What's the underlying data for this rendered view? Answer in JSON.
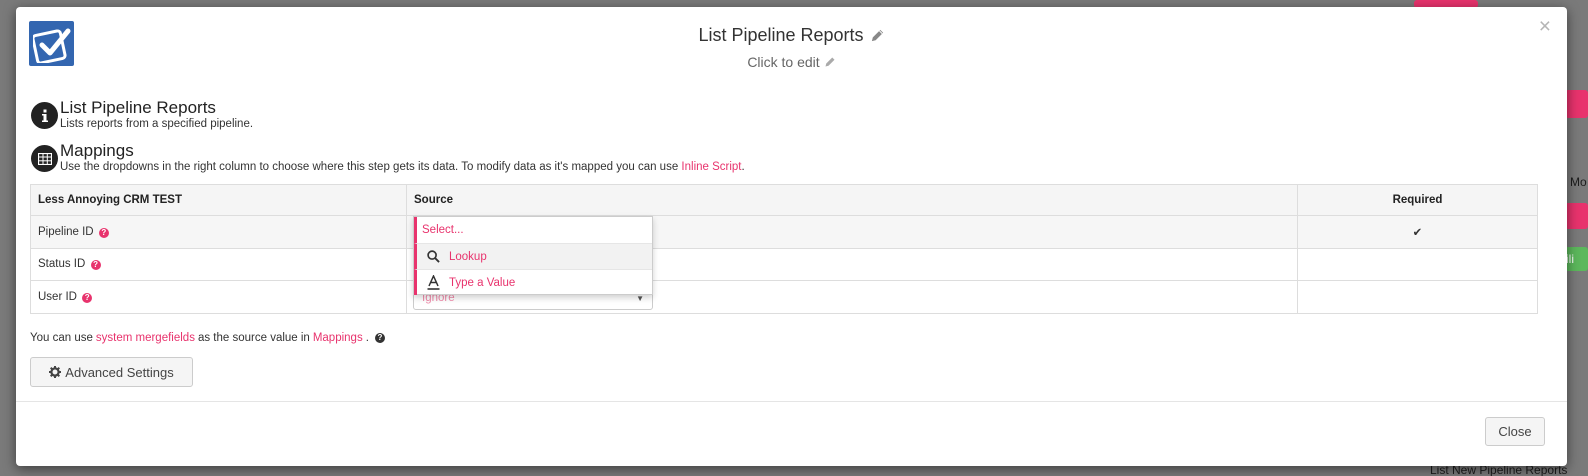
{
  "modal": {
    "title": "List Pipeline Reports",
    "subtitle": "Click to edit",
    "close_x": "×"
  },
  "info_section": {
    "title": "List Pipeline Reports",
    "description": "Lists reports from a specified pipeline."
  },
  "mappings_section": {
    "title": "Mappings",
    "description_prefix": "Use the dropdowns in the right column to choose where this step gets its data. To modify data as it's mapped you can use ",
    "description_link": "Inline Script",
    "description_suffix": "."
  },
  "table": {
    "headers": [
      "Less Annoying CRM TEST",
      "Source",
      "Required"
    ],
    "rows": [
      {
        "field": "Pipeline ID",
        "required": "✔"
      },
      {
        "field": "Status ID",
        "required": ""
      },
      {
        "field": "User ID",
        "required": ""
      }
    ],
    "help_glyph": "?"
  },
  "source_select": {
    "value": "Ignore",
    "dropdown": {
      "placeholder": "Select...",
      "options": [
        "Lookup",
        "Type a Value"
      ]
    }
  },
  "note": {
    "prefix": "You can use ",
    "link1": "system mergefields",
    "middle": " as the source value in ",
    "link2": "Mappings",
    "suffix": ".",
    "help_glyph": "?"
  },
  "buttons": {
    "advanced_settings": "Advanced Settings",
    "close": "Close"
  },
  "colors": {
    "accent": "#e8336d",
    "logo_blue": "#3366b0"
  },
  "background": {
    "right_labels": [
      "Mo",
      "ili",
      "List New Pipeline Reports"
    ]
  }
}
